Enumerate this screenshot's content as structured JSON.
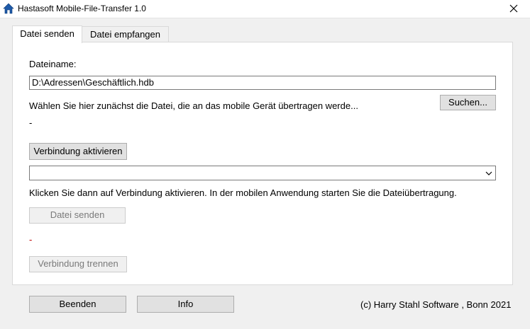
{
  "window": {
    "title": "Hastasoft Mobile-File-Transfer 1.0",
    "icon": "home-icon",
    "close_icon": "close-icon"
  },
  "tabs": [
    {
      "label": "Datei senden",
      "active": true
    },
    {
      "label": "Datei empfangen",
      "active": false
    }
  ],
  "form": {
    "filename_label": "Dateiname:",
    "filename_value": "D:\\Adressen\\Geschäftlich.hdb",
    "search_button": "Suchen...",
    "instruction_file": "Wählen Sie hier zunächst die Datei, die an das mobile Gerät übertragen werde...",
    "status_1": "-",
    "activate_button": "Verbindung aktivieren",
    "connection_select_value": "",
    "instruction_connect": "Klicken Sie dann auf Verbindung aktivieren. In der mobilen Anwendung starten Sie die Dateiübertragung.",
    "send_button": "Datei senden",
    "status_2": "-",
    "disconnect_button": "Verbindung trennen"
  },
  "footer": {
    "quit_button": "Beenden",
    "info_button": "Info",
    "copyright": "(c) Harry Stahl Software , Bonn 2021"
  },
  "colors": {
    "status_2": "#c00000",
    "app_icon": "#1e5aa8"
  }
}
